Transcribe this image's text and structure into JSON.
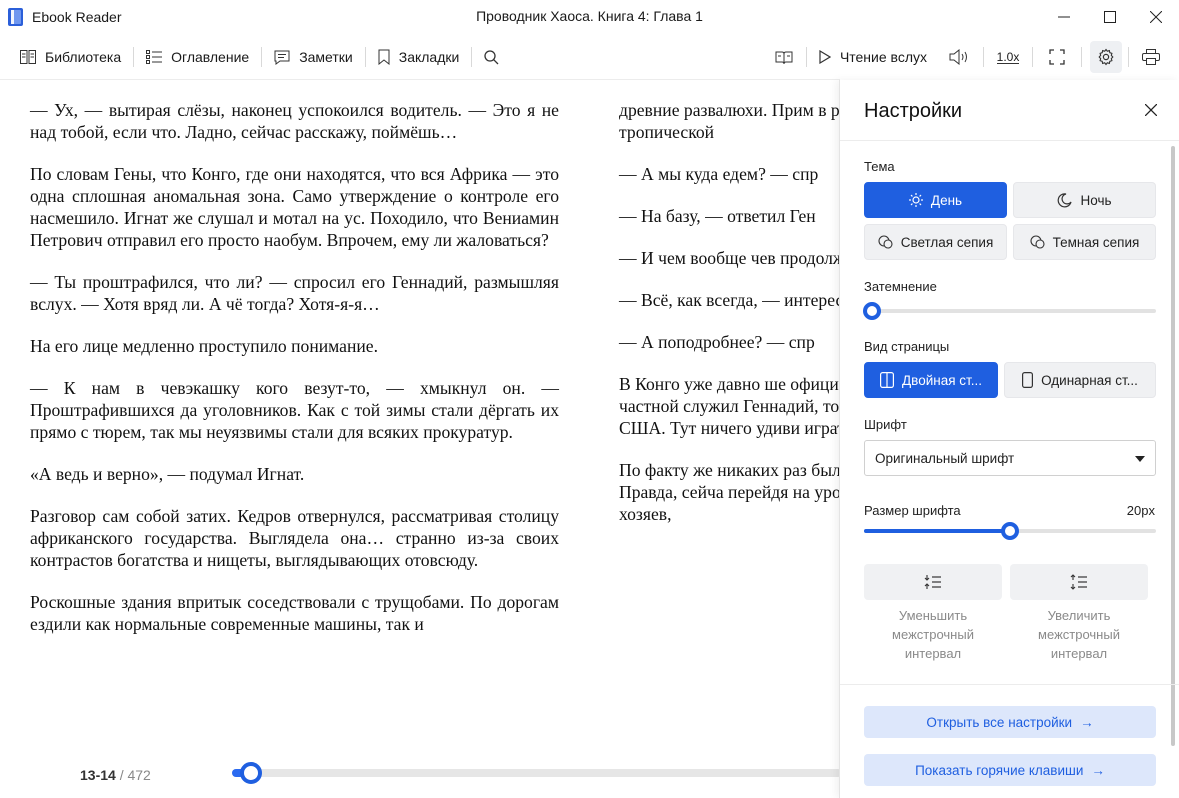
{
  "app": {
    "name": "Ebook Reader",
    "window_title": "Проводник Хаоса. Книга 4: Глава 1"
  },
  "toolbar": {
    "library": "Библиотека",
    "contents": "Оглавление",
    "notes": "Заметки",
    "bookmarks": "Закладки",
    "read_aloud": "Чтение вслух",
    "speed": "1.0x"
  },
  "page_left": [
    "— Ух, — вытирая слёзы, наконец успокоился водитель. — Это я не над тобой, если что. Ладно, сейчас расскажу, поймёшь…",
    "По словам Гены, что Конго, где они находятся, что вся Африка — это одна сплошная аномальная зона. Само утверждение о контроле его насмешило. Игнат же слушал и мотал на ус. Походило, что Вениамин Петрович отправил его просто наобум. Впрочем, ему ли жаловаться?",
    "— Ты проштрафился, что ли? — спросил его Геннадий, размышляя вслух. — Хотя вряд ли. А чё тогда? Хотя-я-я…",
    "На его лице медленно проступило понимание.",
    "— К нам в чевэкашку кого везут-то, — хмыкнул он. — Проштрафившихся да уголовников. Как с той зимы стали дёргать их прямо с тюрем, так мы неуязвимы стали для всяких прокуратур.",
    "«А ведь и верно», — подумал Игнат.",
    "Разговор сам собой затих. Кедров отвернулся, рассматривая столицу африканского государства. Выглядела она… странно из-за своих контрастов богатства и нищеты, выглядывающих отовсюду.",
    "Роскошные здания впритык соседствовали с трущобами. По дорогам ездили как нормальные современные машины, так и"
  ],
  "page_right": [
    "древние развалюхи. Прим в разномастных наряда обрамлении тропической",
    "— А мы куда едем? — спр",
    "— На базу, — ответил Ген",
    "— И чем вообще чев продолжал изучать тему Н",
    "— Всё, как всегда, — интересы Родины там, где",
    "— А поподробнее? — спр",
    "В Конго уже давно ше официальными властя поддерживались частной служил Геннадий, то ес храбрых борцов с «тиран США. Тут ничего удиви играть в спасителей мира",
    "По факту же никаких раз было. И те, и другие – влияния. Правда, сейча перейдя на уровень вялы собственно, и у хозяев,"
  ],
  "footer": {
    "current_pages": "13-14",
    "separator": "/",
    "total_pages": "472",
    "progress": 0.02
  },
  "settings": {
    "title": "Настройки",
    "theme_label": "Тема",
    "themes": {
      "day": "День",
      "night": "Ночь",
      "light_sepia": "Светлая сепия",
      "dark_sepia": "Темная сепия"
    },
    "dim_label": "Затемнение",
    "dim_value": 0.0,
    "view_label": "Вид страницы",
    "views": {
      "double": "Двойная ст...",
      "single": "Одинарная ст..."
    },
    "font_label": "Шрифт",
    "font_value": "Оригинальный шрифт",
    "font_size_label": "Размер шрифта",
    "font_size_value": "20px",
    "font_size_fraction": 0.5,
    "decrease_spacing": "Уменьшить межстрочный интервал",
    "increase_spacing": "Увеличить межстрочный интервал",
    "open_all": "Открыть все настройки",
    "hotkeys": "Показать горячие клавиши",
    "arrow": "→"
  },
  "colors": {
    "accent": "#1f5fe0",
    "accent_light": "#dde7fb"
  }
}
